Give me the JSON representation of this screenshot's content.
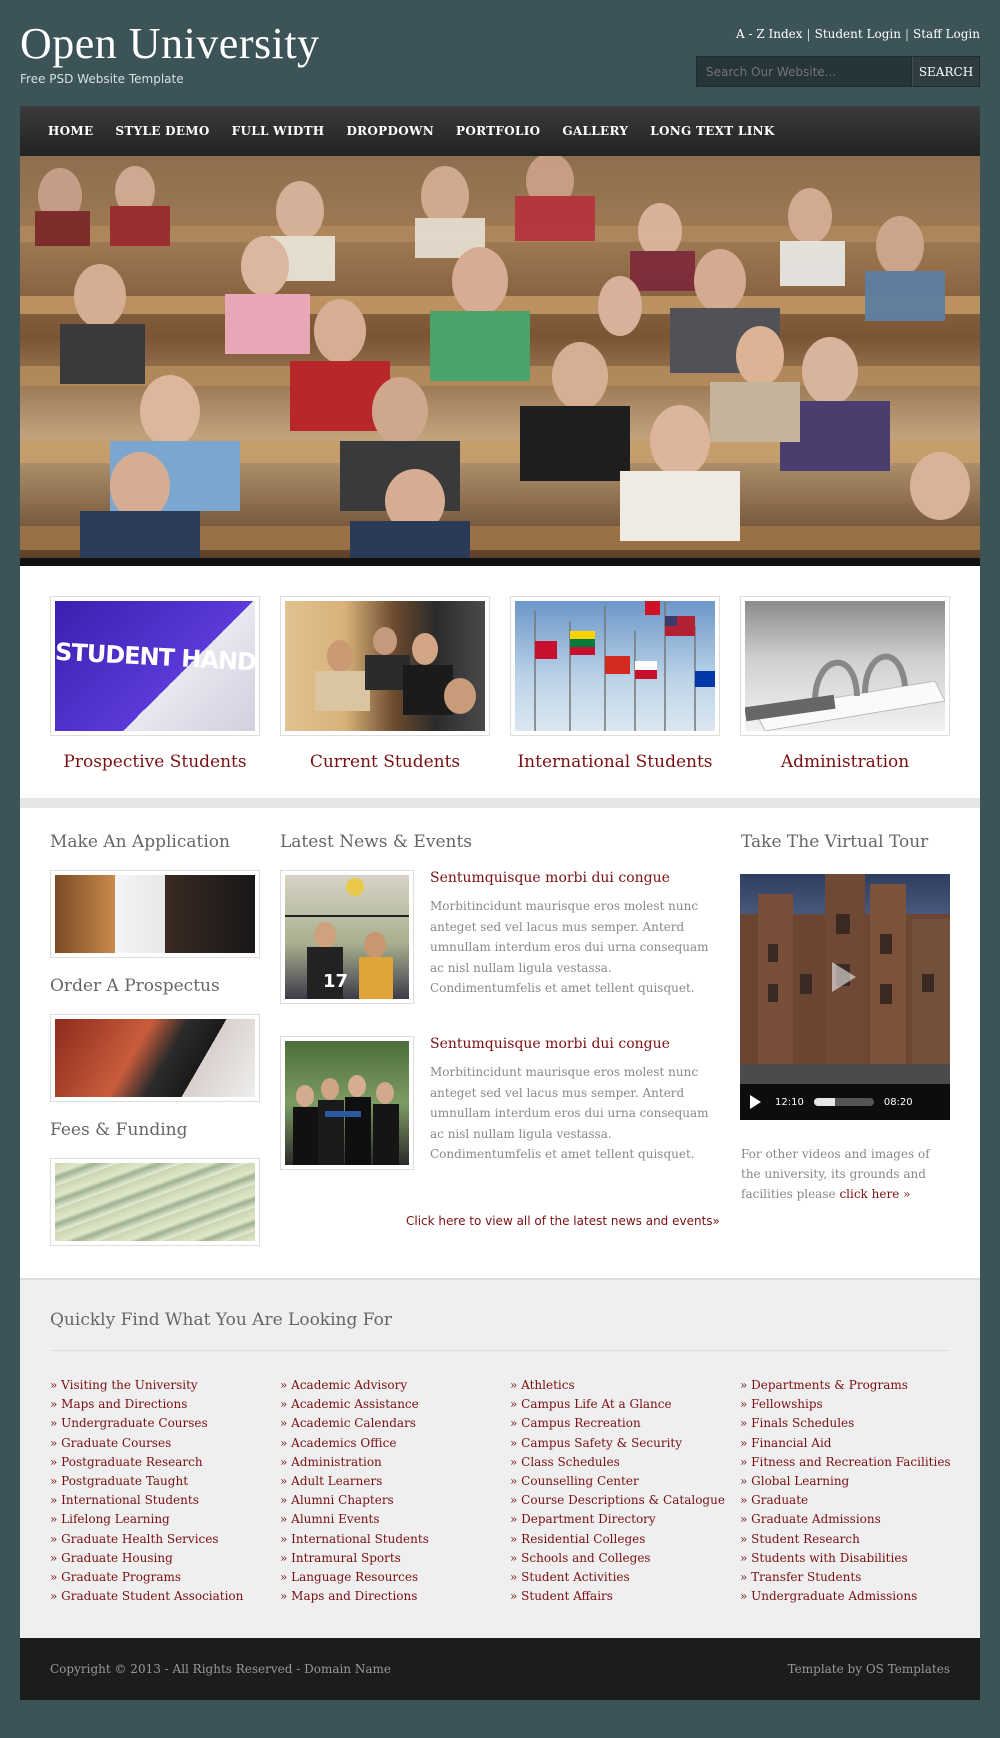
{
  "header": {
    "title": "Open University",
    "tagline": "Free PSD Website Template",
    "toplinks": [
      "A - Z Index",
      "Student Login",
      "Staff Login"
    ],
    "search_placeholder": "Search Our Website...",
    "search_button": "SEARCH"
  },
  "nav": [
    "HOME",
    "STYLE DEMO",
    "FULL WIDTH",
    "DROPDOWN",
    "PORTFOLIO",
    "GALLERY",
    "LONG TEXT LINK"
  ],
  "quick_links": [
    {
      "label": "Prospective Students",
      "thumb_text": "STUDENT HANDBOOK"
    },
    {
      "label": "Current Students"
    },
    {
      "label": "International Students"
    },
    {
      "label": "Administration"
    }
  ],
  "sidebar": {
    "application_title": "Make An Application",
    "prospectus_title": "Order A Prospectus",
    "fees_title": "Fees & Funding"
  },
  "news": {
    "title": "Latest News & Events",
    "items": [
      {
        "title": "Sentumquisque morbi dui congue",
        "body": "Morbitincidunt maurisque eros molest nunc anteget sed vel lacus mus semper. Anterd umnullam interdum eros dui urna consequam ac nisl nullam ligula vestassa. Condimentumfelis et amet tellent quisquet.",
        "jersey": "17"
      },
      {
        "title": "Sentumquisque morbi dui congue",
        "body": "Morbitincidunt maurisque eros molest nunc anteget sed vel lacus mus semper. Anterd umnullam interdum eros dui urna consequam ac nisl nullam ligula vestassa. Condimentumfelis et amet tellent quisquet."
      }
    ],
    "more_link": "Click here to view all of the latest news and events»"
  },
  "tour": {
    "title": "Take The Virtual Tour",
    "time_current": "12:10",
    "time_total": "08:20",
    "progress": 0.35,
    "note": "For other videos and images of the university, its grounds and facilities please",
    "note_link": "click here »"
  },
  "find": {
    "title": "Quickly Find What You Are Looking For",
    "columns": [
      [
        "Visiting the University",
        "Maps and Directions",
        "Undergraduate Courses",
        "Graduate Courses",
        "Postgraduate Research",
        "Postgraduate Taught",
        "International Students",
        "Lifelong Learning",
        "Graduate Health Services",
        "Graduate Housing",
        "Graduate Programs",
        "Graduate Student Association"
      ],
      [
        "Academic Advisory",
        "Academic Assistance",
        "Academic Calendars",
        "Academics Office",
        "Administration",
        "Adult Learners",
        "Alumni Chapters",
        "Alumni Events",
        "International Students",
        "Intramural Sports",
        "Language Resources",
        "Maps and Directions"
      ],
      [
        "Athletics",
        "Campus Life At a Glance",
        "Campus Recreation",
        "Campus Safety & Security",
        "Class Schedules",
        "Counselling Center",
        "Course Descriptions & Catalogue",
        "Department Directory",
        "Residential Colleges",
        "Schools and Colleges",
        "Student Activities",
        "Student Affairs"
      ],
      [
        "Departments & Programs",
        "Fellowships",
        "Finals Schedules",
        "Financial Aid",
        "Fitness and Recreation Facilities",
        "Global Learning",
        "Graduate",
        "Graduate Admissions",
        "Student Research",
        "Students with Disabilities",
        "Transfer Students",
        "Undergraduate Admissions"
      ]
    ]
  },
  "footer": {
    "copyright": "Copyright © 2013 - All Rights Reserved - Domain Name",
    "credit": "Template by OS Templates"
  },
  "colors": {
    "page_bg": "#3c5358",
    "accent": "#7a0f12",
    "nav_bg": "#2c2c2c",
    "footer_bg": "#1c1c1c"
  }
}
